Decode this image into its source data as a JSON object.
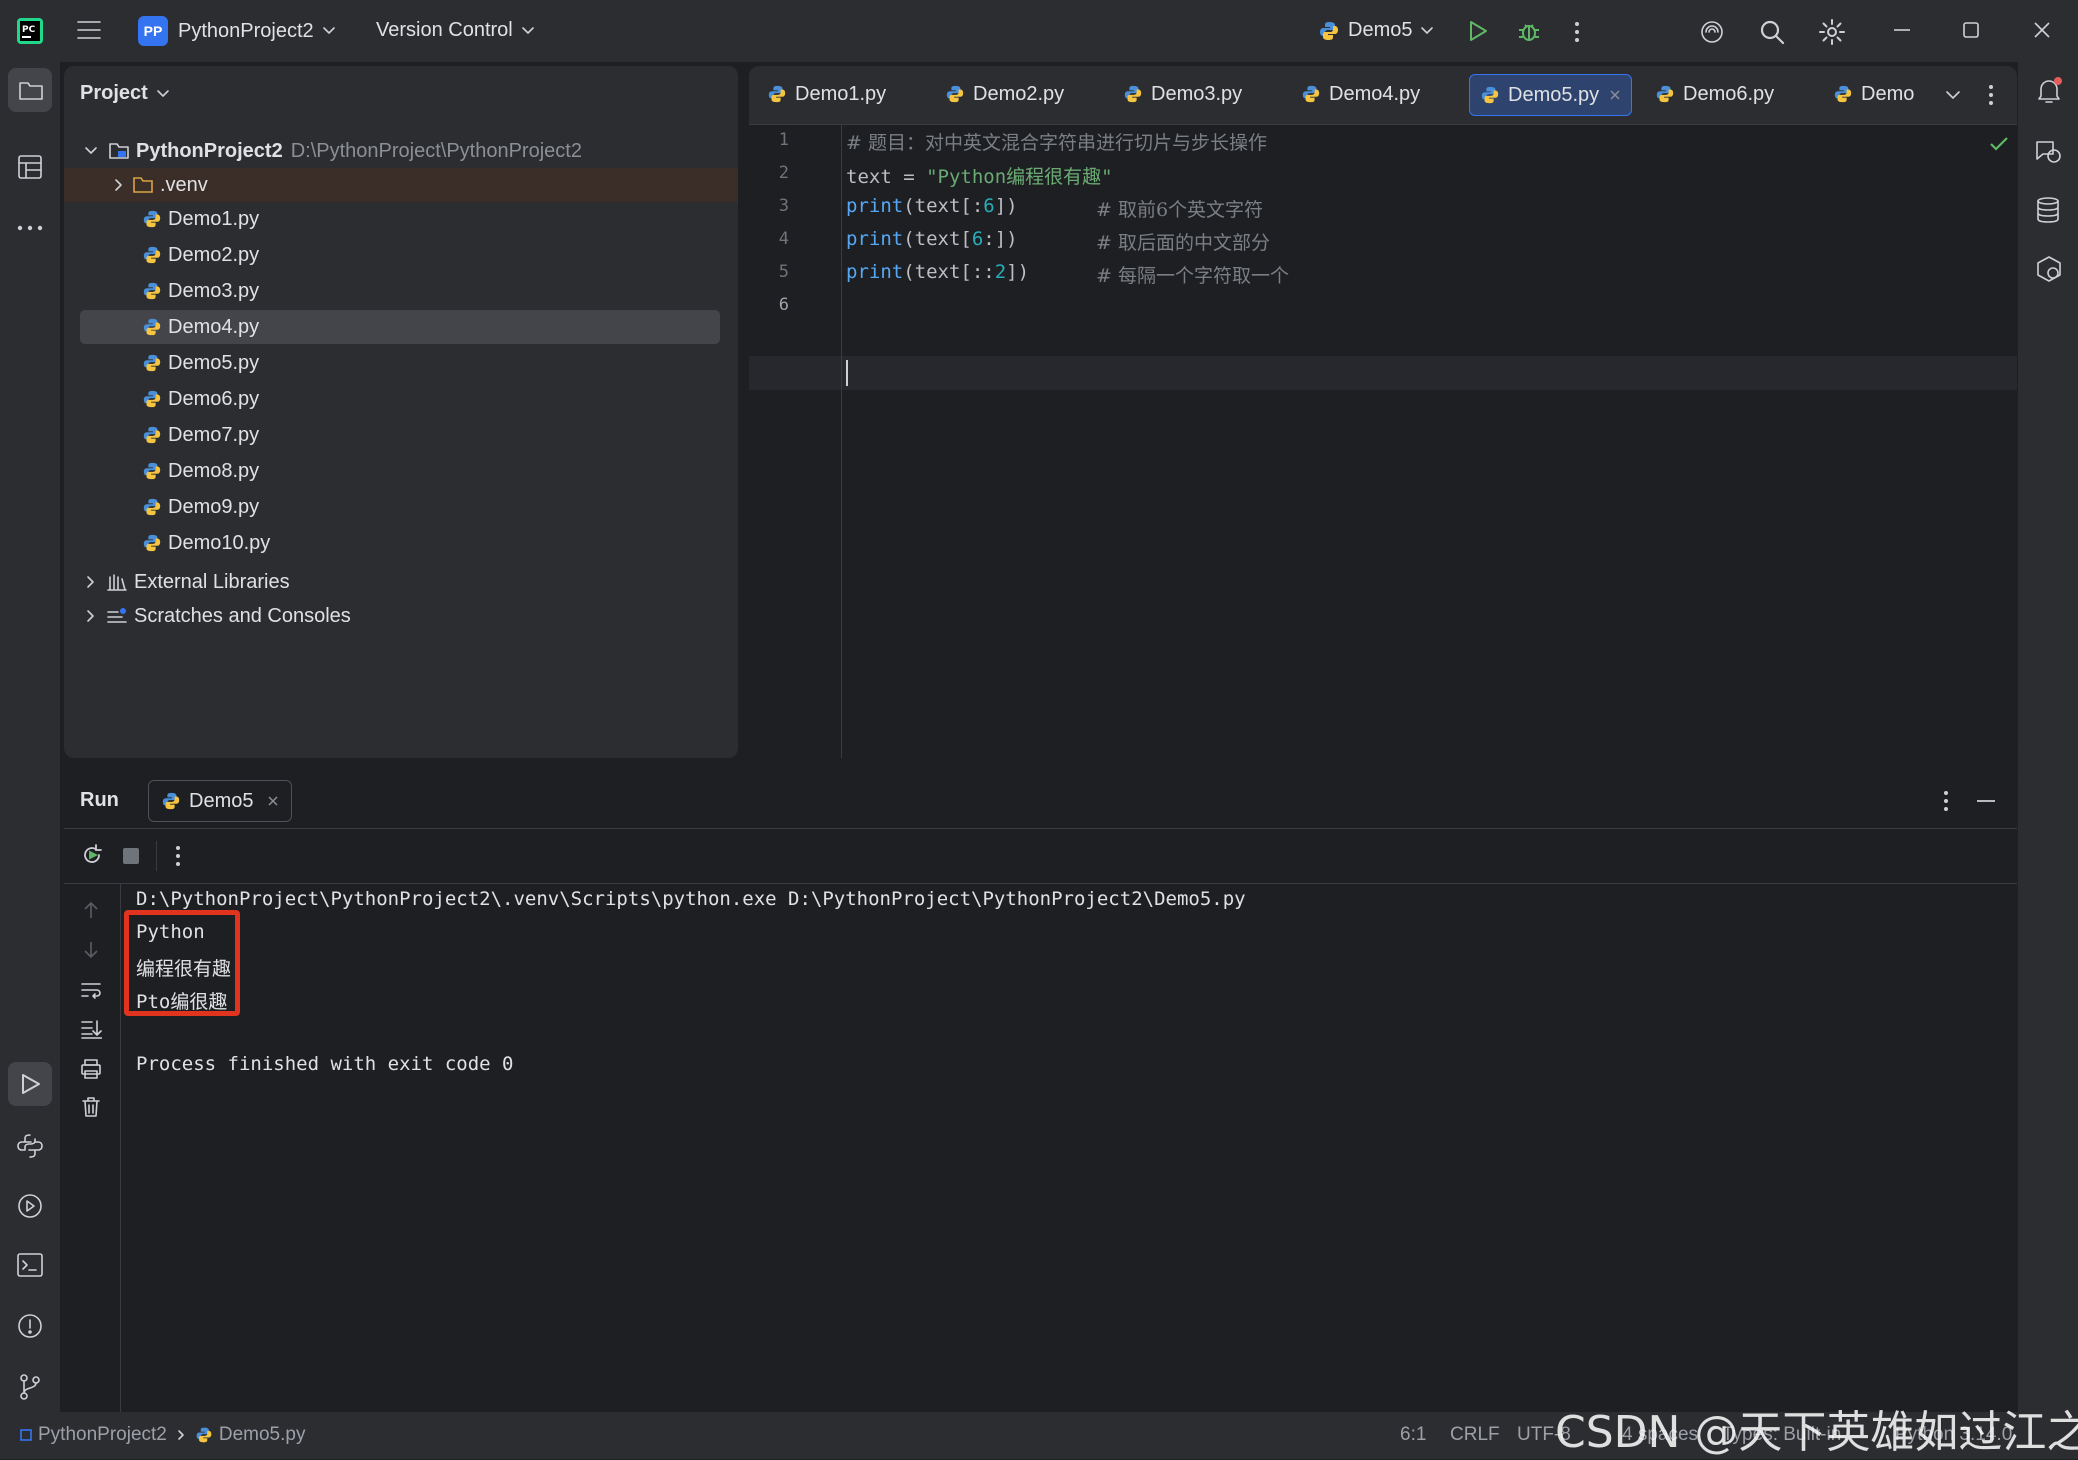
{
  "titlebar": {
    "project_badge": "PP",
    "project_name": "PythonProject2",
    "vcs": "Version Control",
    "run_config": "Demo5"
  },
  "project_panel": {
    "title": "Project",
    "root_name": "PythonProject2",
    "root_path": "D:\\PythonProject\\PythonProject2",
    "venv": ".venv",
    "files": [
      "Demo1.py",
      "Demo2.py",
      "Demo3.py",
      "Demo4.py",
      "Demo5.py",
      "Demo6.py",
      "Demo7.py",
      "Demo8.py",
      "Demo9.py",
      "Demo10.py"
    ],
    "selected_file": "Demo4.py",
    "external_libraries": "External Libraries",
    "scratches": "Scratches and Consoles"
  },
  "editor": {
    "tabs": [
      "Demo1.py",
      "Demo2.py",
      "Demo3.py",
      "Demo4.py",
      "Demo5.py",
      "Demo6.py",
      "Demo"
    ],
    "active_tab": "Demo5.py",
    "line_numbers": [
      "1",
      "2",
      "3",
      "4",
      "5",
      "6"
    ],
    "lines": {
      "l1_comment": "# 题目：对中英文混合字符串进行切片与步长操作",
      "l2_var": "text",
      "l2_eq": " = ",
      "l2_str": "\"Python编程很有趣\"",
      "l3_fn": "print",
      "l3_a": "(text[:",
      "l3_num": "6",
      "l3_b": "])",
      "l3_comment": "# 取前6个英文字符",
      "l4_fn": "print",
      "l4_a": "(text[",
      "l4_num": "6",
      "l4_b": ":])",
      "l4_comment": "# 取后面的中文部分",
      "l5_fn": "print",
      "l5_a": "(text[::",
      "l5_num": "2",
      "l5_b": "])",
      "l5_comment": "# 每隔一个字符取一个"
    }
  },
  "run": {
    "title": "Run",
    "tab": "Demo5",
    "command": "D:\\PythonProject\\PythonProject2\\.venv\\Scripts\\python.exe D:\\PythonProject\\PythonProject2\\Demo5.py",
    "output": [
      "Python",
      "编程很有趣",
      "Pto编很趣"
    ],
    "exit_message": "Process finished with exit code 0"
  },
  "statusbar": {
    "breadcrumb_project": "PythonProject2",
    "breadcrumb_file": "Demo5.py",
    "position": "6:1",
    "line_ending": "CRLF",
    "encoding": "UTF-8",
    "indent": "4 spaces",
    "types": "Types: Built-in",
    "interpreter": "Python 3.14.0"
  },
  "watermark": "CSDN @天下英雄如过江之鲫",
  "colors": {
    "accent": "#3574f0",
    "highlight_box": "#e0341e",
    "ok_check": "#5fb865"
  }
}
